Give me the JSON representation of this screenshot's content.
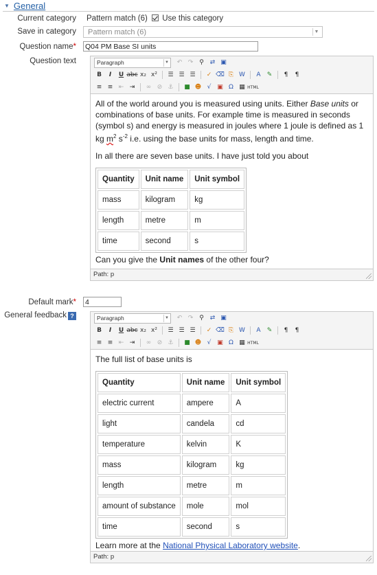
{
  "section": {
    "title": "General"
  },
  "current_category": {
    "label": "Current category",
    "value": "Pattern match (6)",
    "checkbox_label": "Use this category"
  },
  "save_in_category": {
    "label": "Save in category",
    "value": "Pattern match (6)"
  },
  "question_name": {
    "label": "Question name",
    "required_mark": "*",
    "value": "Q04 PM Base SI units"
  },
  "question_text": {
    "label": "Question text",
    "format": "Paragraph",
    "path": "Path: p",
    "para1_a": "All of the world around you is measured using units. Either ",
    "para1_em": "Base units",
    "para1_b": " or combinations of base units. For example time is measured in seconds (symbol s) and energy is measured in joules where 1 joule is defined as 1 kg ",
    "para1_m": "m",
    "para1_sup2": "2",
    "para1_c": " s",
    "para1_supm2": "-2",
    "para1_d": " i.e. using the base units for mass, length and time.",
    "para2": "In all there are seven base units. I have just told you about",
    "table_headers": [
      "Quantity",
      "Unit name",
      "Unit symbol"
    ],
    "table_rows": [
      [
        "mass",
        "kilogram",
        "kg"
      ],
      [
        "length",
        "metre",
        "m"
      ],
      [
        "time",
        "second",
        "s"
      ]
    ],
    "closing_a": "Can you give the ",
    "closing_bold": "Unit names",
    "closing_b": " of the other four?"
  },
  "default_mark": {
    "label": "Default mark",
    "required_mark": "*",
    "value": "4"
  },
  "general_feedback": {
    "label": "General feedback",
    "help_icon": "?",
    "format": "Paragraph",
    "path": "Path: p",
    "intro": "The full list of base units is",
    "table_headers": [
      "Quantity",
      "Unit name",
      "Unit symbol"
    ],
    "table_rows": [
      [
        "electric current",
        "ampere",
        "A"
      ],
      [
        "light",
        "candela",
        "cd"
      ],
      [
        "temperature",
        "kelvin",
        "K"
      ],
      [
        "mass",
        "kilogram",
        "kg"
      ],
      [
        "length",
        "metre",
        "m"
      ],
      [
        "amount of substance",
        "mole",
        "mol"
      ],
      [
        "time",
        "second",
        "s"
      ]
    ],
    "learn_a": "Learn more at the ",
    "learn_link": "National Physical Laboratory website",
    "learn_b": "."
  },
  "colors": {
    "accent_link": "#2460a6",
    "required": "#cc0000",
    "help_icon_bg": "#3a6ab0"
  }
}
